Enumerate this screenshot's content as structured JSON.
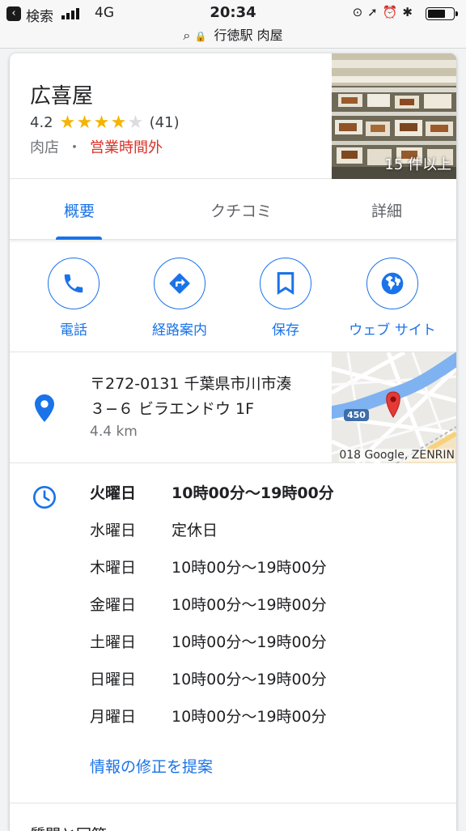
{
  "status_bar": {
    "back_label": "検索",
    "network": "4G",
    "time": "20:34",
    "icons": [
      "rotation-lock-icon",
      "location-icon",
      "alarm-icon",
      "bluetooth-icon"
    ],
    "battery_level": 0.7
  },
  "url_bar": {
    "text": "行徳駅 肉屋"
  },
  "place": {
    "name": "広喜屋",
    "rating": "4.2",
    "stars_filled": 4,
    "review_count": "(41)",
    "category": "肉店",
    "separator": "・",
    "status": "営業時間外",
    "photo_count": "15 件以上"
  },
  "tabs": [
    {
      "label": "概要",
      "active": true
    },
    {
      "label": "クチコミ",
      "active": false
    },
    {
      "label": "詳細",
      "active": false
    }
  ],
  "actions": [
    {
      "label": "電話",
      "icon": "phone-icon"
    },
    {
      "label": "経路案内",
      "icon": "directions-icon"
    },
    {
      "label": "保存",
      "icon": "bookmark-icon"
    },
    {
      "label": "ウェブ サイト",
      "icon": "globe-icon"
    }
  ],
  "address": {
    "line1": "〒272-0131 千葉県市川市湊",
    "line2": "３−６ ビラエンドウ 1F",
    "distance": "4.4 km",
    "map_credit": "018 Google, ZENRIN",
    "map_route": "450"
  },
  "hours": [
    {
      "day": "火曜日",
      "time": "10時00分～19時00分",
      "today": true
    },
    {
      "day": "水曜日",
      "time": "定休日",
      "today": false
    },
    {
      "day": "木曜日",
      "time": "10時00分～19時00分",
      "today": false
    },
    {
      "day": "金曜日",
      "time": "10時00分～19時00分",
      "today": false
    },
    {
      "day": "土曜日",
      "time": "10時00分～19時00分",
      "today": false
    },
    {
      "day": "日曜日",
      "time": "10時00分～19時00分",
      "today": false
    },
    {
      "day": "月曜日",
      "time": "10時00分～19時00分",
      "today": false
    }
  ],
  "suggest_edit": "情報の修正を提案",
  "next_section": "質問と回答",
  "colors": {
    "accent": "#1a73e8",
    "closed": "#d93025",
    "star": "#f4b400"
  }
}
